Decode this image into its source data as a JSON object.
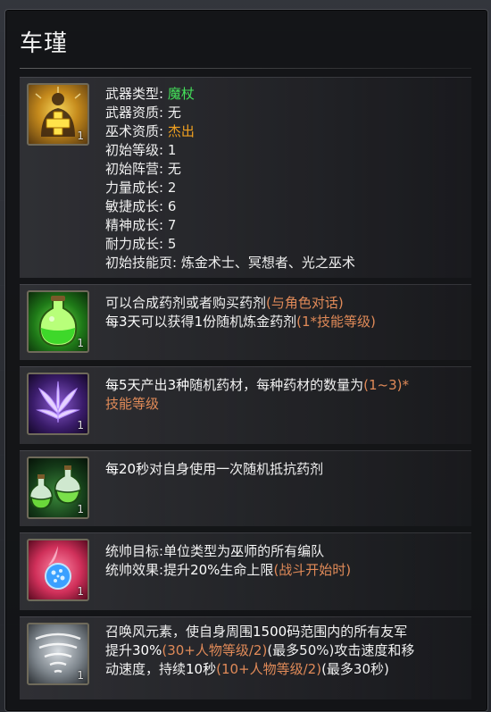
{
  "hero_name": "车瑾",
  "info": {
    "icon": "healer-cross-icon",
    "level_badge": "1",
    "lines": [
      {
        "label": "武器类型:",
        "value": "魔杖",
        "color": "#44e25a"
      },
      {
        "label": "武器资质:",
        "value": "无",
        "color": "#f0f0f0"
      },
      {
        "label": "巫术资质:",
        "value": "杰出",
        "color": "#f0a020"
      },
      {
        "label": "初始等级:",
        "value": "1",
        "color": "#f0f0f0"
      },
      {
        "label": "初始阵营:",
        "value": "无",
        "color": "#f0f0f0"
      },
      {
        "label": "力量成长:",
        "value": "2",
        "color": "#f0f0f0"
      },
      {
        "label": "敏捷成长:",
        "value": "6",
        "color": "#f0f0f0"
      },
      {
        "label": "精神成长:",
        "value": "7",
        "color": "#f0f0f0"
      },
      {
        "label": "耐力成长:",
        "value": "5",
        "color": "#f0f0f0"
      },
      {
        "label": "初始技能页:",
        "value": "炼金术士、冥想者、光之巫术",
        "color": "#f0f0f0"
      }
    ]
  },
  "skills": [
    {
      "icon": "green-potion-icon",
      "level_badge": "1",
      "lines": [
        [
          {
            "t": "可以合成药剂或者购买药剂",
            "c": "w"
          },
          {
            "t": "(与角色对话)",
            "c": "s"
          }
        ],
        [
          {
            "t": "每3天",
            "c": "b"
          },
          {
            "t": "可以获得",
            "c": "w"
          },
          {
            "t": "1份",
            "c": "b"
          },
          {
            "t": "随机炼金药剂",
            "c": "w"
          },
          {
            "t": "(1*技能等级)",
            "c": "s"
          }
        ]
      ]
    },
    {
      "icon": "purple-herb-icon",
      "level_badge": "1",
      "lines": [
        [
          {
            "t": "每5天",
            "c": "b"
          },
          {
            "t": "产出",
            "c": "w"
          },
          {
            "t": "3种",
            "c": "b"
          },
          {
            "t": "随机药材，每种药材的数量为",
            "c": "w"
          },
          {
            "t": "(1~3)*",
            "c": "s"
          }
        ],
        [
          {
            "t": "技能等级",
            "c": "s"
          }
        ]
      ]
    },
    {
      "icon": "potion-bottles-icon",
      "level_badge": "1",
      "lines": [
        [
          {
            "t": "每20秒",
            "c": "b"
          },
          {
            "t": "对自身使用一次随机抵抗药剂",
            "c": "w"
          }
        ]
      ]
    },
    {
      "icon": "blue-orb-icon",
      "level_badge": "1",
      "lines": [
        [
          {
            "t": "统帅目标:",
            "c": "w"
          },
          {
            "t": "单位类型为",
            "c": "w"
          },
          {
            "t": "巫师",
            "c": "b"
          },
          {
            "t": "的所有编队",
            "c": "w"
          }
        ],
        [
          {
            "t": "统帅效果:",
            "c": "w"
          },
          {
            "t": "提升",
            "c": "w"
          },
          {
            "t": "20%",
            "c": "b"
          },
          {
            "t": "生命上限",
            "c": "w"
          },
          {
            "t": "(战斗开始时)",
            "c": "s"
          }
        ]
      ]
    },
    {
      "icon": "whirlwind-icon",
      "level_badge": "1",
      "lines": [
        [
          {
            "t": "召唤风元素，使自身周围",
            "c": "w"
          },
          {
            "t": "1500码",
            "c": "b"
          },
          {
            "t": "范围内的所有友军",
            "c": "w"
          }
        ],
        [
          {
            "t": "提升",
            "c": "w"
          },
          {
            "t": "30%",
            "c": "b"
          },
          {
            "t": "(30+人物等级/2)",
            "c": "s"
          },
          {
            "t": "(最多50%)",
            "c": "w"
          },
          {
            "t": "攻击速度和移",
            "c": "w"
          }
        ],
        [
          {
            "t": "动速度，持续",
            "c": "w"
          },
          {
            "t": "10秒",
            "c": "b"
          },
          {
            "t": "(10+人物等级/2)",
            "c": "s"
          },
          {
            "t": "(最多30秒)",
            "c": "w"
          }
        ]
      ]
    }
  ]
}
